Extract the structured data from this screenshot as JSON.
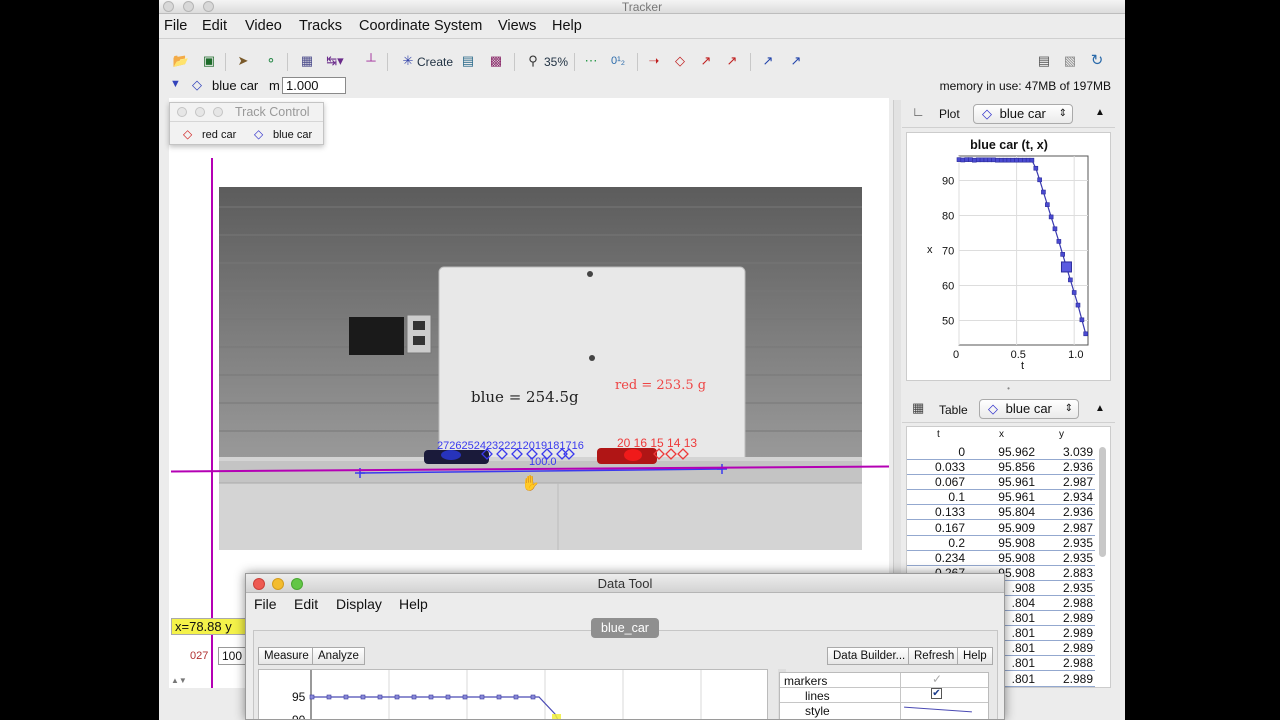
{
  "window": {
    "title": "Tracker"
  },
  "menu": [
    "File",
    "Edit",
    "Video",
    "Tracks",
    "Coordinate System",
    "Views",
    "Help"
  ],
  "toolbar": {
    "create_label": "Create",
    "zoom_label": "35%",
    "memory": "memory in use: 47MB of 197MB"
  },
  "trackbar": {
    "track_name": "blue car",
    "mass_label": "m",
    "mass_value": "1.000"
  },
  "track_control": {
    "title": "Track Control",
    "tracks": [
      "red car",
      "blue car"
    ]
  },
  "video": {
    "whiteboard_blue": "blue = 254.5g",
    "whiteboard_red": "red = 253.5 g",
    "blue_frame_labels": "272625242322212019181716",
    "red_frame_labels": "20 16 15 14 13",
    "calibration_label": "100.0"
  },
  "coord_readout": "x=78.88 y",
  "bottom_left": {
    "frame": "027",
    "field": "100"
  },
  "plot_view": {
    "label": "Plot",
    "track": "blue car",
    "title": "blue car (t, x)",
    "xlabel": "t",
    "ylabel": "x"
  },
  "table_view": {
    "label": "Table",
    "track": "blue car",
    "headers": [
      "t",
      "x",
      "y"
    ],
    "rows": [
      [
        "0",
        "95.962",
        "3.039"
      ],
      [
        "0.033",
        "95.856",
        "2.936"
      ],
      [
        "0.067",
        "95.961",
        "2.987"
      ],
      [
        "0.1",
        "95.961",
        "2.934"
      ],
      [
        "0.133",
        "95.804",
        "2.936"
      ],
      [
        "0.167",
        "95.909",
        "2.987"
      ],
      [
        "0.2",
        "95.908",
        "2.935"
      ],
      [
        "0.234",
        "95.908",
        "2.935"
      ],
      [
        "0.267",
        "95.908",
        "2.883"
      ],
      [
        "",
        ".908",
        "2.935"
      ],
      [
        "",
        ".804",
        "2.988"
      ],
      [
        "",
        ".801",
        "2.989"
      ],
      [
        "",
        ".801",
        "2.989"
      ],
      [
        "",
        ".801",
        "2.989"
      ],
      [
        "",
        ".801",
        "2.988"
      ],
      [
        "",
        ".801",
        "2.989"
      ]
    ]
  },
  "data_tool": {
    "title": "Data Tool",
    "menu": [
      "File",
      "Edit",
      "Display",
      "Help"
    ],
    "tab": "blue_car",
    "left_buttons": [
      "Measure",
      "Analyze"
    ],
    "right_buttons": [
      "Data Builder...",
      "Refresh",
      "Help"
    ],
    "props": [
      "markers",
      "lines",
      "style"
    ],
    "ytick_95": "95",
    "ytick_90": "90"
  },
  "chart_data": {
    "type": "line",
    "title": "blue car (t, x)",
    "xlabel": "t",
    "ylabel": "x",
    "xlim": [
      0,
      1.12
    ],
    "ylim": [
      43,
      97
    ],
    "xticks": [
      0,
      0.5,
      1.0
    ],
    "yticks": [
      50,
      60,
      70,
      80,
      90
    ],
    "xtick_labels": [
      "0",
      "0.5",
      "1.0"
    ],
    "ytick_labels": [
      "50",
      "60",
      "70",
      "80",
      "90"
    ],
    "grid": true,
    "series": [
      {
        "name": "blue car",
        "color": "#3232c8",
        "x": [
          0,
          0.033,
          0.067,
          0.1,
          0.133,
          0.167,
          0.2,
          0.234,
          0.267,
          0.3,
          0.333,
          0.367,
          0.4,
          0.433,
          0.467,
          0.5,
          0.533,
          0.567,
          0.6,
          0.633,
          0.667,
          0.7,
          0.733,
          0.767,
          0.8,
          0.833,
          0.867,
          0.9,
          0.933,
          0.967,
          1.0,
          1.033,
          1.067,
          1.1
        ],
        "y": [
          95.96,
          95.86,
          95.96,
          95.96,
          95.8,
          95.91,
          95.91,
          95.91,
          95.91,
          95.91,
          95.8,
          95.8,
          95.8,
          95.8,
          95.8,
          95.8,
          95.8,
          95.8,
          95.8,
          95.8,
          93.5,
          90.2,
          86.7,
          83.1,
          79.6,
          76.2,
          72.6,
          68.9,
          65.3,
          61.6,
          58.0,
          54.4,
          50.2,
          46.2
        ]
      }
    ]
  }
}
